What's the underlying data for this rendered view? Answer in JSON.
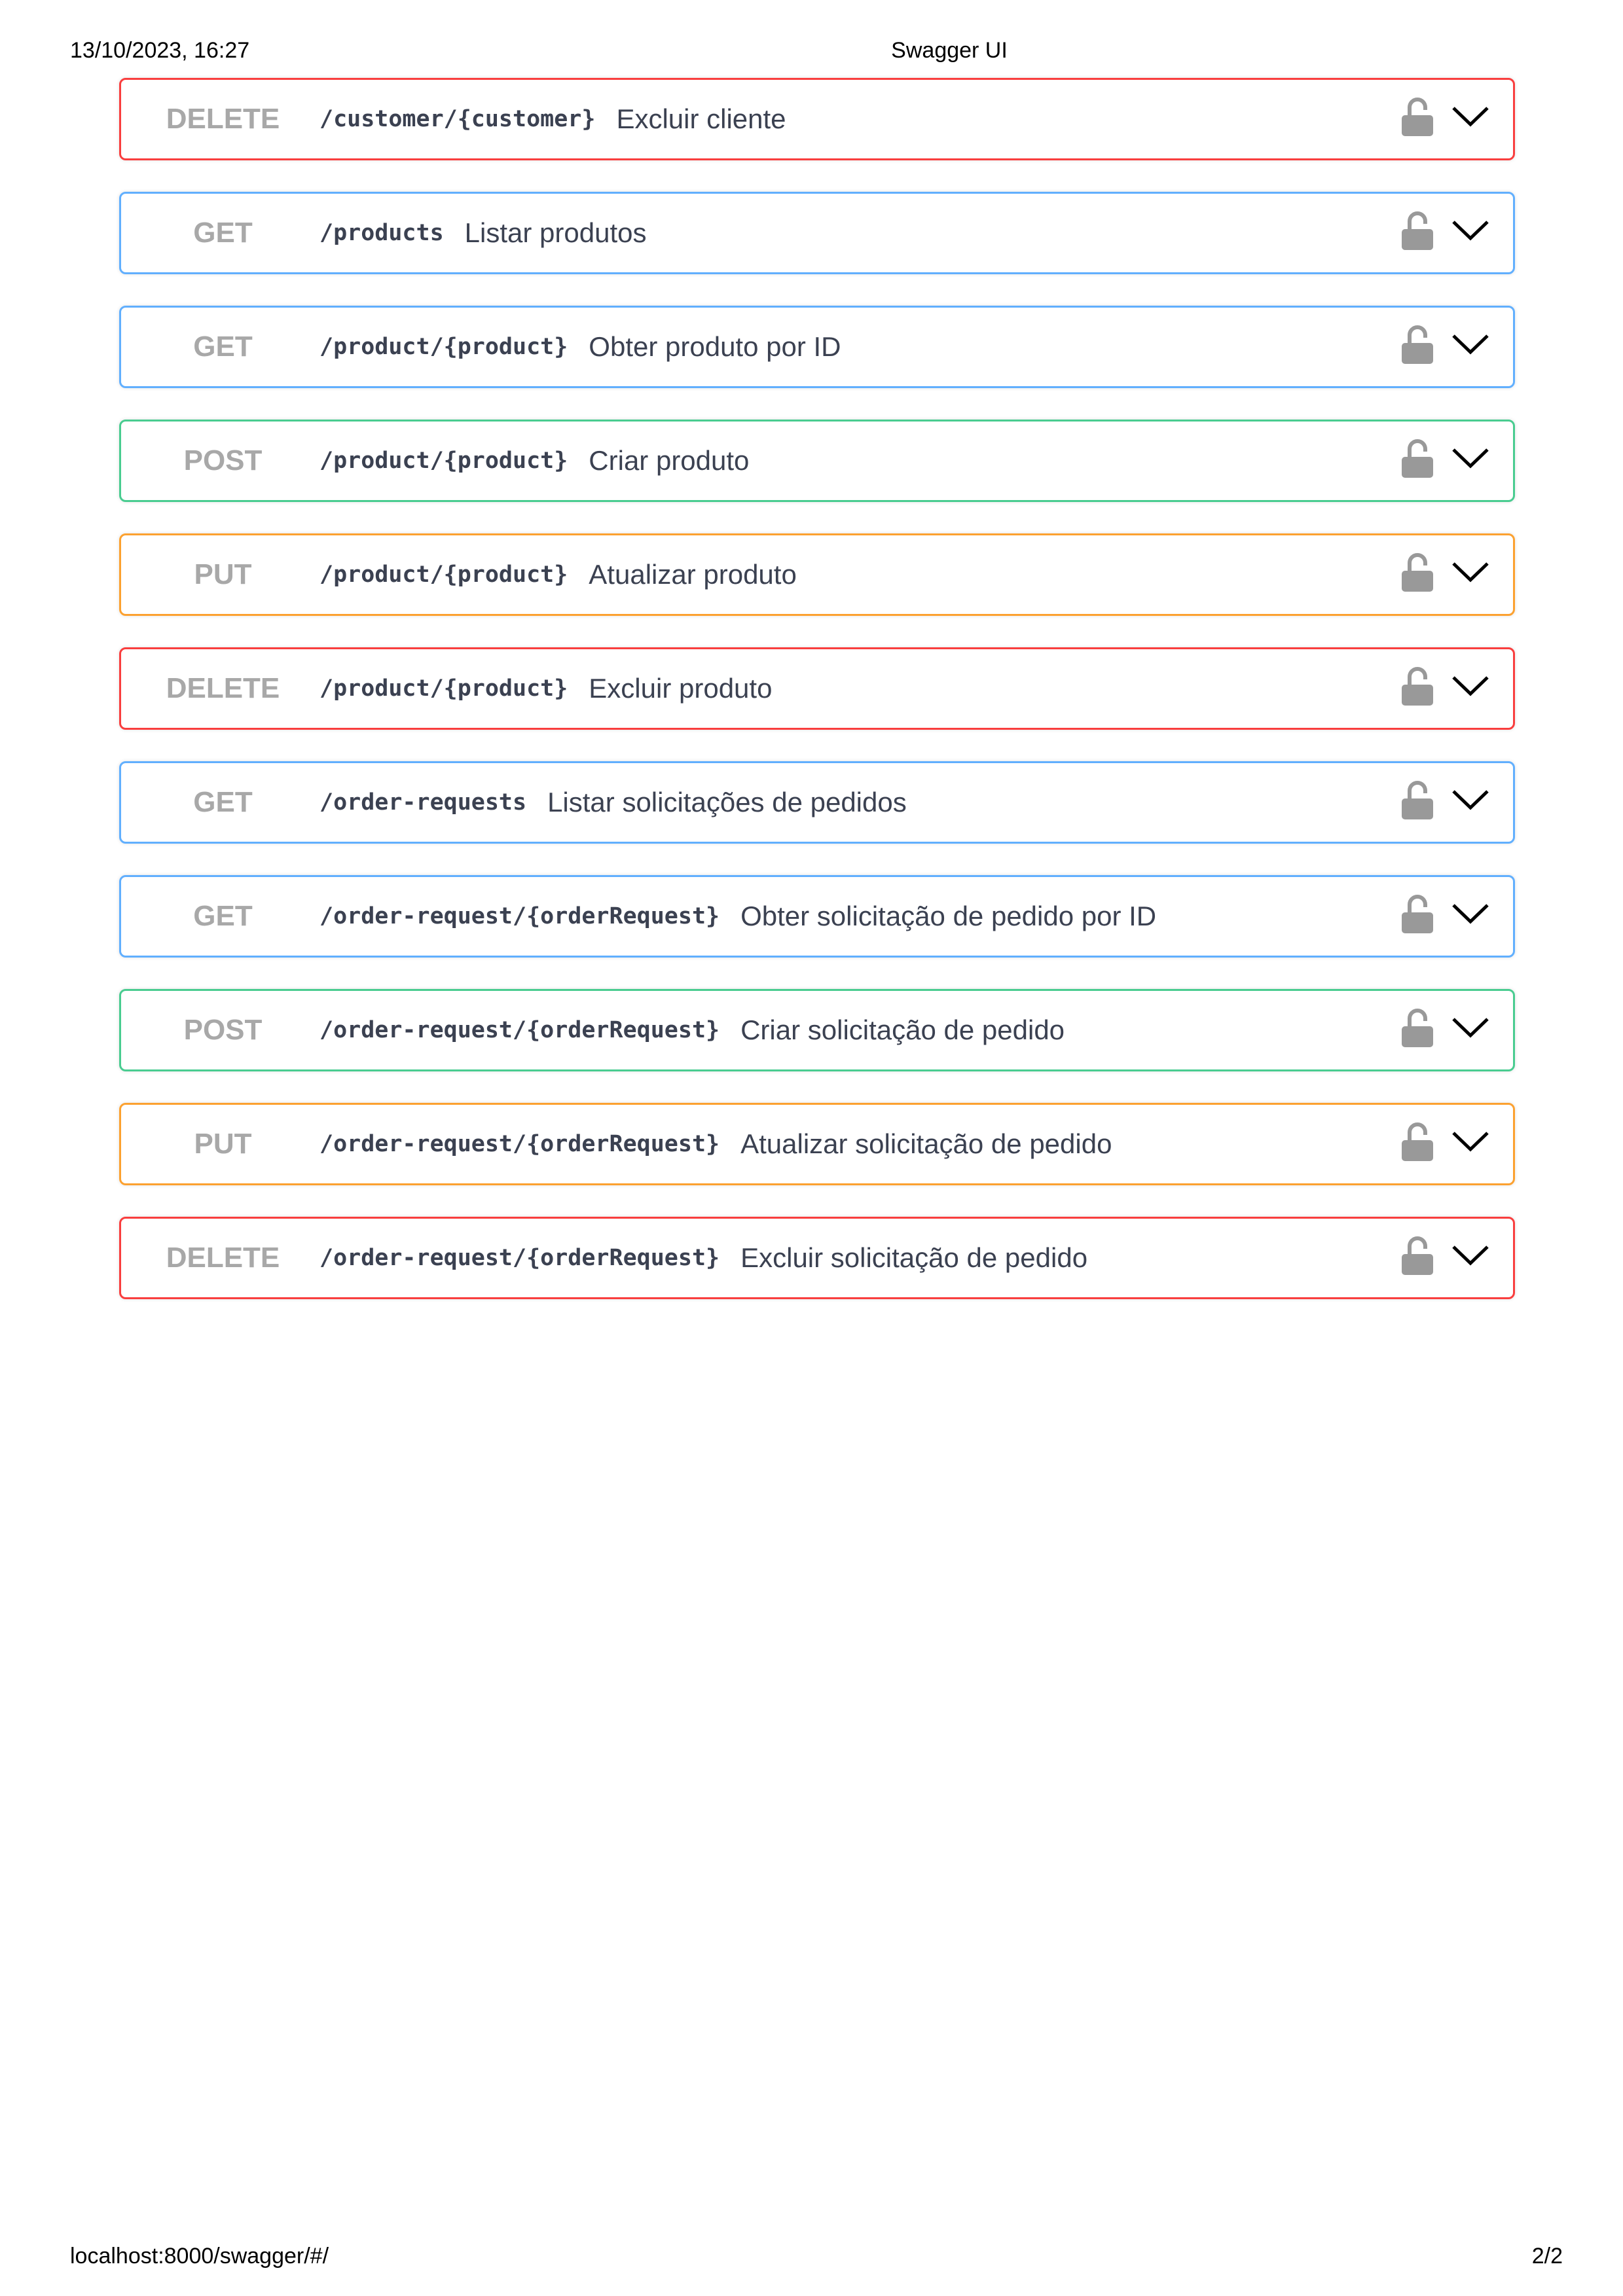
{
  "print_header": {
    "datetime": "13/10/2023, 16:27",
    "title": "Swagger UI"
  },
  "print_footer": {
    "url": "localhost:8000/swagger/#/",
    "page": "2/2"
  },
  "colors": {
    "get": "#61affe",
    "post": "#49cc90",
    "put": "#fca130",
    "delete": "#f93e3e",
    "method_text": "#a8a8a8",
    "icon": "#999999"
  },
  "operations": [
    {
      "method": "DELETE",
      "path": "/customer/{customer}",
      "summary": "Excluir cliente"
    },
    {
      "method": "GET",
      "path": "/products",
      "summary": "Listar produtos"
    },
    {
      "method": "GET",
      "path": "/product/{product}",
      "summary": "Obter produto por ID"
    },
    {
      "method": "POST",
      "path": "/product/{product}",
      "summary": "Criar produto"
    },
    {
      "method": "PUT",
      "path": "/product/{product}",
      "summary": "Atualizar produto"
    },
    {
      "method": "DELETE",
      "path": "/product/{product}",
      "summary": "Excluir produto"
    },
    {
      "method": "GET",
      "path": "/order-requests",
      "summary": "Listar solicitações de pedidos"
    },
    {
      "method": "GET",
      "path": "/order-request/{orderRequest}",
      "summary": "Obter solicitação de pedido por ID"
    },
    {
      "method": "POST",
      "path": "/order-request/{orderRequest}",
      "summary": "Criar solicitação de pedido"
    },
    {
      "method": "PUT",
      "path": "/order-request/{orderRequest}",
      "summary": "Atualizar solicitação de pedido"
    },
    {
      "method": "DELETE",
      "path": "/order-request/{orderRequest}",
      "summary": "Excluir solicitação de pedido"
    }
  ],
  "icons": {
    "lock": "unlocked-padlock-icon",
    "expand": "chevron-down-icon"
  }
}
